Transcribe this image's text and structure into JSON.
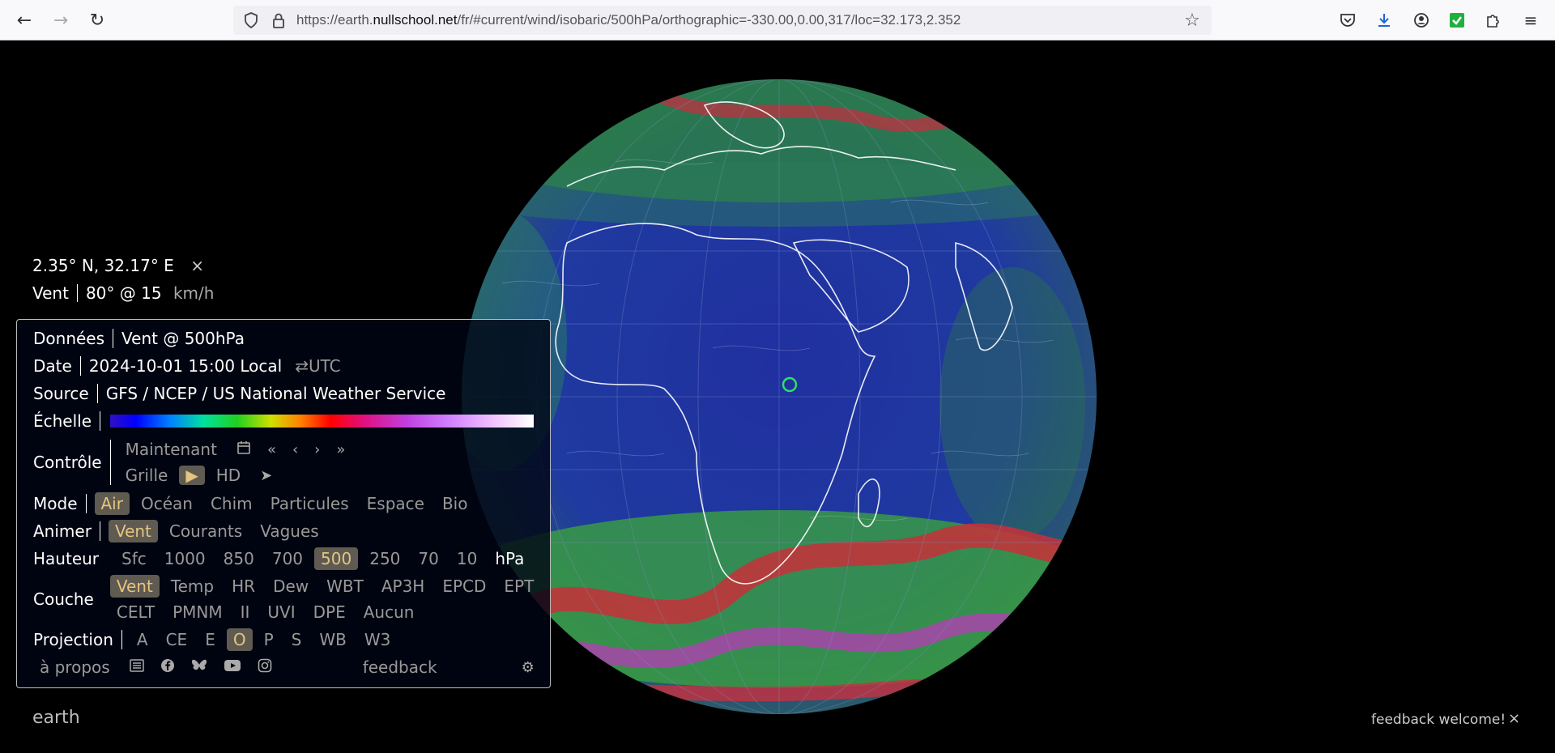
{
  "browser": {
    "url_prefix": "https://earth.",
    "url_domain": "nullschool.net",
    "url_suffix": "/fr/#current/wind/isobaric/500hPa/orthographic=-330.00,0.00,317/loc=32.173,2.352"
  },
  "location": {
    "coords": "2.35° N, 32.17° E",
    "close": "×",
    "label": "Vent",
    "value": "80° @ 15",
    "unit": "km/h"
  },
  "panel": {
    "data_label": "Données",
    "data_value": "Vent @ 500hPa",
    "date_label": "Date",
    "date_value": "2024-10-01 15:00 Local",
    "utc_toggle": "⇄UTC",
    "source_label": "Source",
    "source_value": "GFS / NCEP / US National Weather Service",
    "scale_label": "Échelle",
    "control_label": "Contrôle",
    "now_label": "Maintenant",
    "grid_label": "Grille",
    "hd_label": "HD",
    "mode_label": "Mode",
    "mode_options": [
      "Air",
      "Océan",
      "Chim",
      "Particules",
      "Espace",
      "Bio"
    ],
    "animate_label": "Animer",
    "animate_options": [
      "Vent",
      "Courants",
      "Vagues"
    ],
    "height_label": "Hauteur",
    "height_options": [
      "Sfc",
      "1000",
      "850",
      "700",
      "500",
      "250",
      "70",
      "10"
    ],
    "height_unit": "hPa",
    "layer_label": "Couche",
    "layer_row1": [
      "Vent",
      "Temp",
      "HR",
      "Dew",
      "WBT",
      "AP3H",
      "EPCD",
      "EPT"
    ],
    "layer_row2": [
      "CELT",
      "PMNM",
      "II",
      "UVI",
      "DPE",
      "Aucun"
    ],
    "projection_label": "Projection",
    "projection_options": [
      "A",
      "CE",
      "E",
      "O",
      "P",
      "S",
      "WB",
      "W3"
    ],
    "about": "à propos",
    "feedback": "feedback"
  },
  "footer": {
    "earth": "earth",
    "feedback_welcome": "feedback welcome!",
    "close": "×"
  },
  "colors": {
    "selected_bg": "#5f5b52",
    "selected_fg": "#e4c47e",
    "ocean": "#1a2a8a",
    "land_outline": "#ffffff"
  }
}
